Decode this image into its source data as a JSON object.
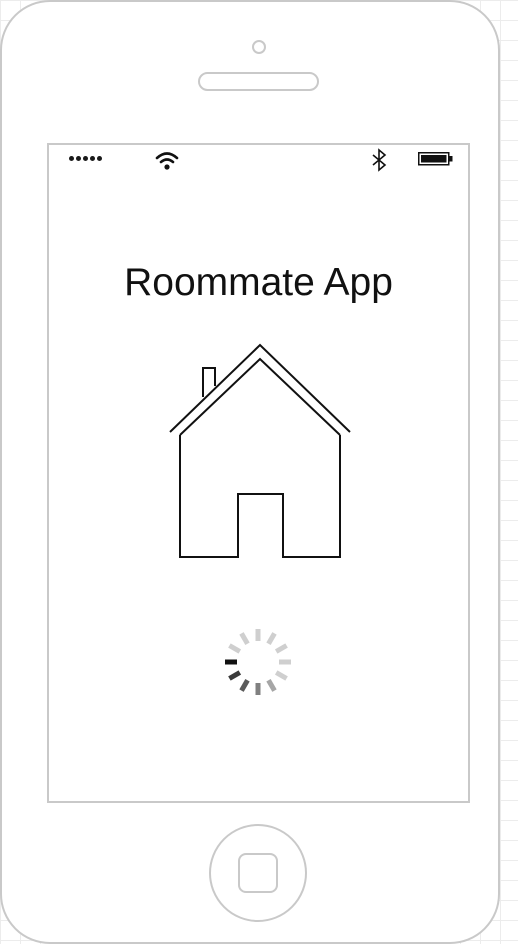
{
  "device": {
    "type": "iphone-wireframe"
  },
  "status_bar": {
    "signal_icon": "signal-dots-icon",
    "wifi_icon": "wifi-icon",
    "bluetooth_icon": "bluetooth-icon",
    "battery_icon": "battery-icon",
    "battery_level": 1.0
  },
  "main": {
    "title": "Roommate App",
    "logo_icon": "house-icon",
    "loading_icon": "activity-spinner-icon"
  },
  "colors": {
    "frame": "#c9c9c9",
    "text": "#111111",
    "icon_stroke": "#111111"
  }
}
